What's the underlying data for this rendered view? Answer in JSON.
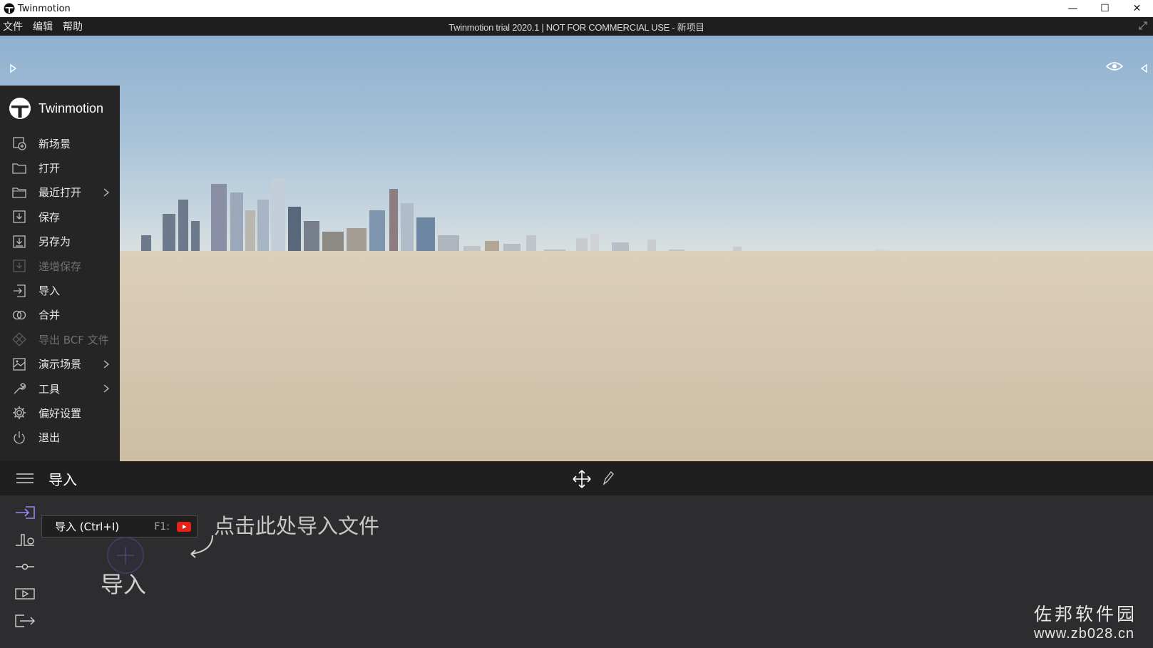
{
  "window": {
    "title": "Twinmotion",
    "controls": {
      "minimize": "—",
      "maximize": "☐",
      "close": "✕"
    }
  },
  "menubar": {
    "items": [
      "文件",
      "编辑",
      "帮助"
    ],
    "title": "Twinmotion trial 2020.1 | NOT FOR COMMERCIAL USE - 新项目"
  },
  "side_menu": {
    "brand": "Twinmotion",
    "items": [
      {
        "label": "新场景",
        "icon": "new-scene-icon",
        "enabled": true,
        "submenu": false
      },
      {
        "label": "打开",
        "icon": "folder-open-icon",
        "enabled": true,
        "submenu": false
      },
      {
        "label": "最近打开",
        "icon": "folder-recent-icon",
        "enabled": true,
        "submenu": true
      },
      {
        "label": "保存",
        "icon": "save-icon",
        "enabled": true,
        "submenu": false
      },
      {
        "label": "另存为",
        "icon": "save-as-icon",
        "enabled": true,
        "submenu": false
      },
      {
        "label": "递增保存",
        "icon": "save-increment-icon",
        "enabled": false,
        "submenu": false
      },
      {
        "label": "导入",
        "icon": "import-icon",
        "enabled": true,
        "submenu": false
      },
      {
        "label": "合并",
        "icon": "merge-icon",
        "enabled": true,
        "submenu": false
      },
      {
        "label": "导出 BCF 文件",
        "icon": "bcf-export-icon",
        "enabled": false,
        "submenu": false
      },
      {
        "label": "演示场景",
        "icon": "demo-scene-icon",
        "enabled": true,
        "submenu": true
      },
      {
        "label": "工具",
        "icon": "wrench-icon",
        "enabled": true,
        "submenu": true
      },
      {
        "label": "偏好设置",
        "icon": "gear-icon",
        "enabled": true,
        "submenu": false
      },
      {
        "label": "退出",
        "icon": "power-icon",
        "enabled": true,
        "submenu": false
      }
    ]
  },
  "panel": {
    "section_title": "导入",
    "tooltip": {
      "text": "导入 (Ctrl+I)",
      "key": "F1:"
    },
    "hint": "点击此处导入文件",
    "import_label": "导入"
  },
  "watermark": {
    "cn": "佐邦软件园",
    "url": "www.zb028.cn"
  },
  "colors": {
    "accent_purple": "#9b86f0",
    "menu_bg": "#252526",
    "panel_bg": "#2d2d30",
    "youtube_red": "#e62117"
  }
}
